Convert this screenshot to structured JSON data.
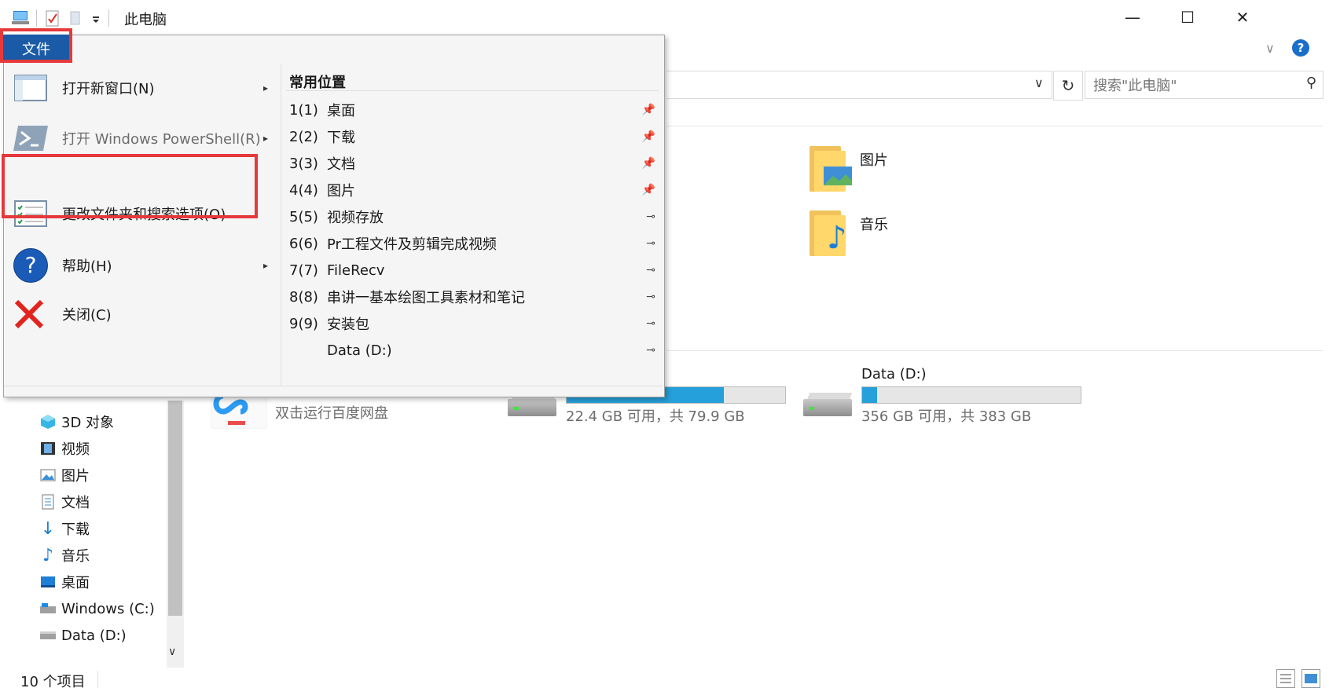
{
  "window": {
    "title": "此电脑",
    "minimize": "—",
    "maximize": "☐",
    "close": "✕"
  },
  "ribbon": {
    "collapse": "∨",
    "help": "?"
  },
  "address": {
    "chevron": "∨",
    "refresh": "↻"
  },
  "search": {
    "placeholder": "搜索\"此电脑\"",
    "icon": "⚲"
  },
  "file_tab": {
    "label": "文件"
  },
  "file_menu": {
    "items": [
      {
        "label": "打开新窗口(N)",
        "arrow": "▸"
      },
      {
        "label": "打开 Windows PowerShell(R)",
        "arrow": "▸"
      },
      {
        "label": "更改文件夹和搜索选项(O)",
        "arrow": ""
      },
      {
        "label": "帮助(H)",
        "arrow": "▸"
      },
      {
        "label": "关闭(C)",
        "arrow": ""
      }
    ],
    "recent_header": "常用位置",
    "recent": [
      {
        "num": "1(1)",
        "name": "桌面",
        "pin": "📌"
      },
      {
        "num": "2(2)",
        "name": "下载",
        "pin": "📌"
      },
      {
        "num": "3(3)",
        "name": "文档",
        "pin": "📌"
      },
      {
        "num": "4(4)",
        "name": "图片",
        "pin": "📌"
      },
      {
        "num": "5(5)",
        "name": "视频存放",
        "pin": "⊸"
      },
      {
        "num": "6(6)",
        "name": "Pr工程文件及剪辑完成视频",
        "pin": "⊸"
      },
      {
        "num": "7(7)",
        "name": "FileRecv",
        "pin": "⊸"
      },
      {
        "num": "8(8)",
        "name": "串讲一基本绘图工具素材和笔记",
        "pin": "⊸"
      },
      {
        "num": "9(9)",
        "name": "安装包",
        "pin": "⊸"
      },
      {
        "num": "",
        "name": "Data (D:)",
        "pin": "⊸"
      }
    ]
  },
  "content": {
    "folders": [
      {
        "label": "图片"
      },
      {
        "label": "音乐"
      }
    ],
    "baidu_label": "双击运行百度网盘",
    "drives": [
      {
        "name": "",
        "usage_text": "22.4 GB 可用，共 79.9 GB",
        "used_fraction": 0.72
      },
      {
        "name": "Data (D:)",
        "usage_text": "356 GB 可用，共 383 GB",
        "used_fraction": 0.07
      }
    ]
  },
  "nav": {
    "items": [
      {
        "label": "3D 对象"
      },
      {
        "label": "视频"
      },
      {
        "label": "图片"
      },
      {
        "label": "文档"
      },
      {
        "label": "下载"
      },
      {
        "label": "音乐"
      },
      {
        "label": "桌面"
      },
      {
        "label": "Windows (C:)"
      },
      {
        "label": "Data (D:)"
      }
    ],
    "scroll_down": "∨"
  },
  "status": {
    "item_count": "10 个项目"
  }
}
